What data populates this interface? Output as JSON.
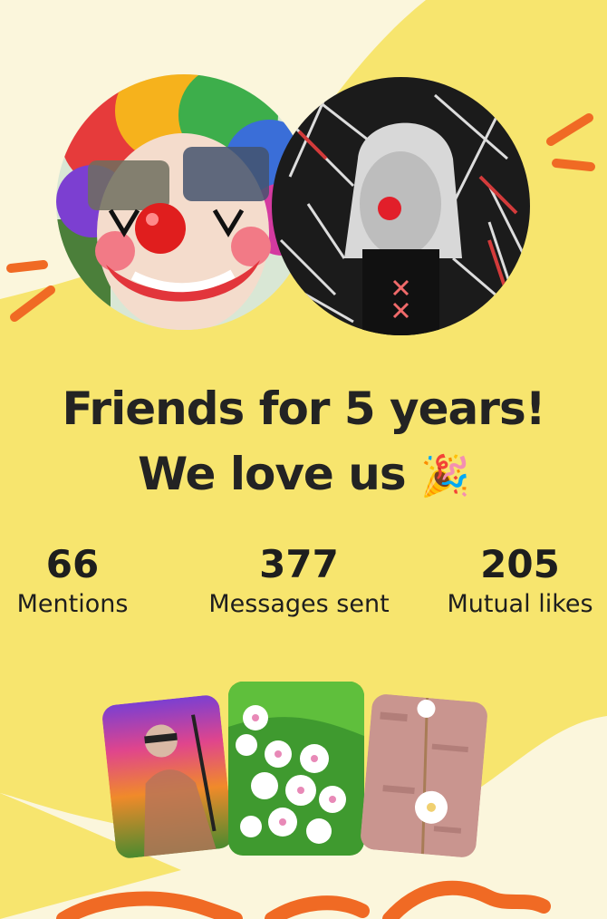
{
  "headline": {
    "line1": "Friends for 5 years!",
    "line2": "We love us",
    "emoji": "🎉"
  },
  "stats": [
    {
      "value": "66",
      "label": "Mentions"
    },
    {
      "value": "377",
      "label": "Messages sent"
    },
    {
      "value": "205",
      "label": "Mutual likes"
    }
  ],
  "avatars": [
    {
      "name": "friend-1",
      "description_icon": "clown-face"
    },
    {
      "name": "friend-2",
      "description_icon": "clown-nose-portrait"
    }
  ],
  "photos": [
    "rainbow-portrait",
    "white-flowers",
    "pink-wall-flower"
  ],
  "colors": {
    "background_light": "#fbf6dc",
    "background_yellow": "#f7e56e",
    "accent_orange": "#f06a24",
    "text": "#232323"
  }
}
